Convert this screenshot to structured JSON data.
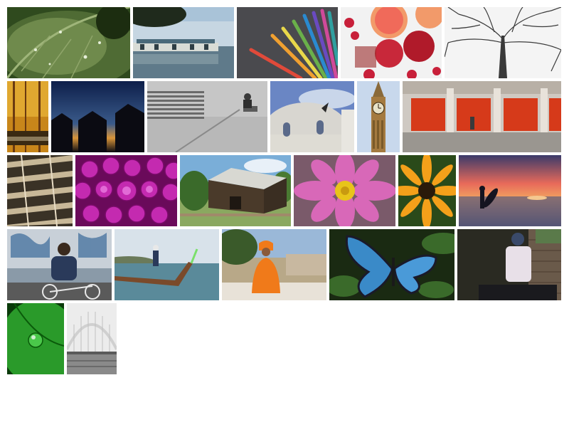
{
  "gallery": {
    "photos": [
      {
        "name": "photo-leaf-water-drops"
      },
      {
        "name": "photo-boathouses-on-lake"
      },
      {
        "name": "photo-colored-pencils"
      },
      {
        "name": "photo-grapefruit-apples-berries"
      },
      {
        "name": "photo-bare-tree-looking-up"
      },
      {
        "name": "photo-autumn-forest-stream"
      },
      {
        "name": "photo-huts-silhouette-dusk"
      },
      {
        "name": "photo-concrete-wall-vent-person"
      },
      {
        "name": "photo-bird-over-domed-building"
      },
      {
        "name": "photo-big-ben-tower"
      },
      {
        "name": "photo-red-garage-doors"
      },
      {
        "name": "photo-spiral-staircase"
      },
      {
        "name": "photo-magenta-dahlia"
      },
      {
        "name": "photo-wooden-barn"
      },
      {
        "name": "photo-pink-cosmos-flower"
      },
      {
        "name": "photo-orange-daisy"
      },
      {
        "name": "photo-surfer-at-sunset"
      },
      {
        "name": "photo-cyclist-graffiti"
      },
      {
        "name": "photo-longtail-boat"
      },
      {
        "name": "photo-monk-in-orange"
      },
      {
        "name": "photo-blue-morpho-butterfly"
      },
      {
        "name": "photo-woman-by-brick-wall"
      },
      {
        "name": "photo-green-leaf-droplet"
      },
      {
        "name": "photo-white-arched-bridge"
      }
    ]
  }
}
